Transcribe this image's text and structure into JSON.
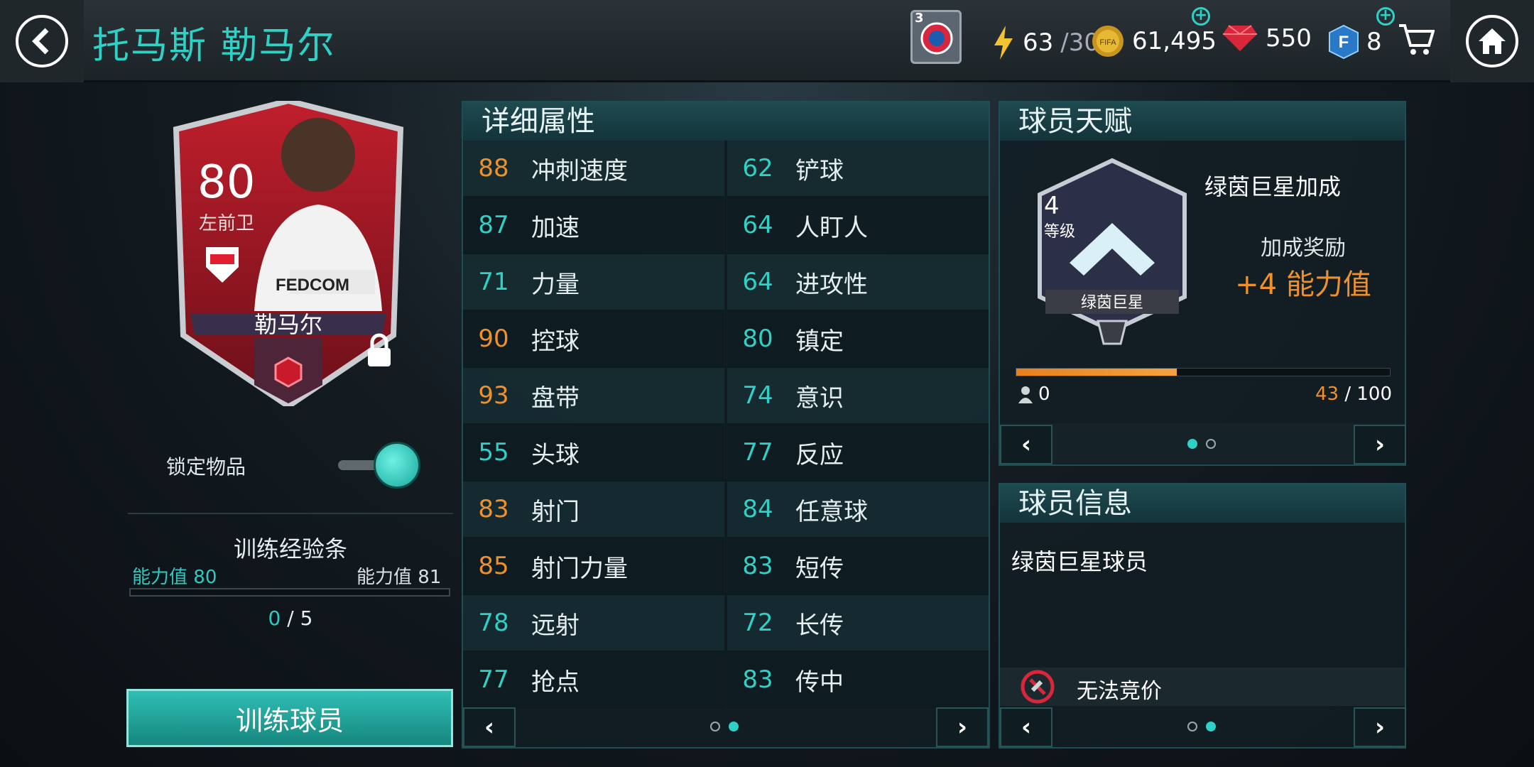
{
  "header": {
    "title": "托马斯 勒马尔",
    "energy": "63",
    "energy_max": "/30",
    "coins": "61,495",
    "gems": "550",
    "fifa_points": "8",
    "badge_level": "3"
  },
  "card": {
    "rating": "80",
    "position": "左前卫",
    "name": "勒马尔",
    "sponsor": "FEDCOM"
  },
  "lock": {
    "label": "锁定物品",
    "enabled": true
  },
  "training": {
    "title": "训练经验条",
    "current_label": "能力值",
    "current_value": "80",
    "next_label": "能力值",
    "next_value": "81",
    "progress": "0",
    "progress_sep": "/",
    "progress_max": "5",
    "progress_fraction": 0,
    "button": "训练球员"
  },
  "stats": {
    "title": "详细属性",
    "left": [
      {
        "v": "88",
        "n": "冲刺速度",
        "c": "o"
      },
      {
        "v": "87",
        "n": "加速",
        "c": "t"
      },
      {
        "v": "71",
        "n": "力量",
        "c": "t"
      },
      {
        "v": "90",
        "n": "控球",
        "c": "o"
      },
      {
        "v": "93",
        "n": "盘带",
        "c": "o"
      },
      {
        "v": "55",
        "n": "头球",
        "c": "t"
      },
      {
        "v": "83",
        "n": "射门",
        "c": "o"
      },
      {
        "v": "85",
        "n": "射门力量",
        "c": "o"
      },
      {
        "v": "78",
        "n": "远射",
        "c": "t"
      },
      {
        "v": "77",
        "n": "抢点",
        "c": "t"
      }
    ],
    "right": [
      {
        "v": "62",
        "n": "铲球",
        "c": "t"
      },
      {
        "v": "64",
        "n": "人盯人",
        "c": "t"
      },
      {
        "v": "64",
        "n": "进攻性",
        "c": "t"
      },
      {
        "v": "80",
        "n": "镇定",
        "c": "t"
      },
      {
        "v": "74",
        "n": "意识",
        "c": "t"
      },
      {
        "v": "77",
        "n": "反应",
        "c": "t"
      },
      {
        "v": "84",
        "n": "任意球",
        "c": "t"
      },
      {
        "v": "83",
        "n": "短传",
        "c": "t"
      },
      {
        "v": "72",
        "n": "长传",
        "c": "t"
      },
      {
        "v": "83",
        "n": "传中",
        "c": "t"
      }
    ]
  },
  "talent": {
    "title": "球员天赋",
    "level": "4",
    "level_label": "等级",
    "badge_label": "绿茵巨星",
    "name": "绿茵巨星加成",
    "bonus_label": "加成奖励",
    "bonus_value": "+4 能力值",
    "min": "0",
    "current": "43",
    "sep": "/",
    "max": "100",
    "progress_fraction": 0.43
  },
  "info": {
    "title": "球员信息",
    "type": "绿茵巨星球员",
    "auction": "无法竞价"
  },
  "colors": {
    "accent": "#2fd0c6",
    "orange": "#f0902a"
  }
}
